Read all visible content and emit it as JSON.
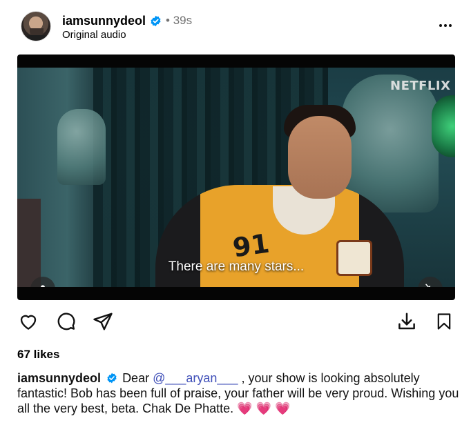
{
  "post": {
    "username": "iamsunnydeol",
    "time": "• 39s",
    "audio": "Original audio",
    "verified": true
  },
  "video": {
    "watermark": "NETFLIX",
    "subtitle": "There are many stars...",
    "muted": true
  },
  "likes": "67 likes",
  "caption": {
    "username": "iamsunnydeol",
    "before_mention": "Dear",
    "mention": "@___aryan___",
    "after_mention": ", your show is looking absolutely fantastic! Bob has been full of praise, your father will be very proud. Wishing you all the very best, beta. Chak De Phatte.",
    "emojis": "💗 💗 💗"
  },
  "colors": {
    "verified_blue": "#0095f6",
    "mention_blue": "#3f4fb8",
    "heart_pink": "#e8457a"
  },
  "icons": [
    "more-options-icon",
    "verified-badge-icon",
    "user-tag-icon",
    "muted-speaker-icon",
    "heart-icon",
    "comment-icon",
    "share-icon",
    "download-icon",
    "bookmark-icon"
  ]
}
